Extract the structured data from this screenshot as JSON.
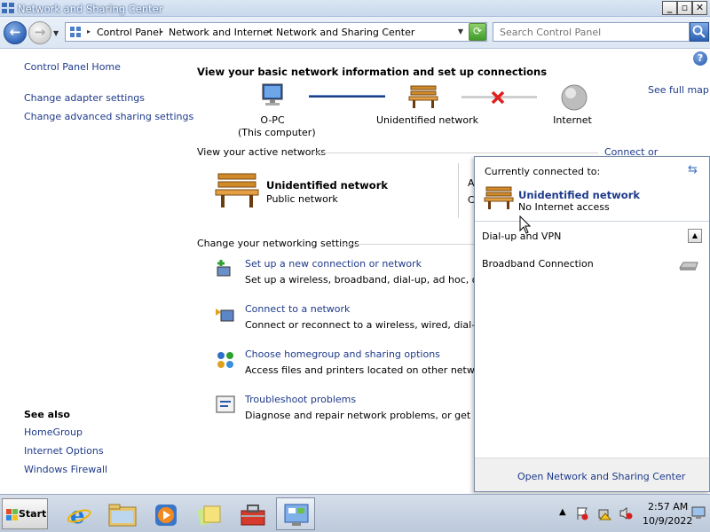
{
  "window": {
    "title": "Network and Sharing Center",
    "controls": {
      "minimize": "_",
      "maximize": "▫",
      "close": "✕"
    }
  },
  "address": {
    "breadcrumbs": [
      "Control Panel",
      "Network and Internet",
      "Network and Sharing Center"
    ],
    "search_placeholder": "Search Control Panel"
  },
  "sidebar": {
    "home": "Control Panel Home",
    "links": [
      "Change adapter settings",
      "Change advanced sharing settings"
    ],
    "see_also_title": "See also",
    "see_also": [
      "HomeGroup",
      "Internet Options",
      "Windows Firewall"
    ]
  },
  "main": {
    "heading": "View your basic network information and set up connections",
    "see_full_map": "See full map",
    "map": {
      "computer_name": "O-PC",
      "computer_sub": "(This computer)",
      "network": "Unidentified network",
      "internet": "Internet"
    },
    "active_networks_label": "View your active networks",
    "connect_or_disconnect": "Connect or disconnect",
    "active_network": {
      "name": "Unidentified network",
      "type": "Public network",
      "partial_a": "A",
      "partial_c": "C"
    },
    "settings_label": "Change your networking settings",
    "tasks": [
      {
        "title": "Set up a new connection or network",
        "desc": "Set up a wireless, broadband, dial-up, ad hoc, or VPN"
      },
      {
        "title": "Connect to a network",
        "desc": "Connect or reconnect to a wireless, wired, dial-up, or"
      },
      {
        "title": "Choose homegroup and sharing options",
        "desc": "Access files and printers located on other network cor"
      },
      {
        "title": "Troubleshoot problems",
        "desc": "Diagnose and repair network problems, or get trouble"
      }
    ]
  },
  "flyout": {
    "currently_connected": "Currently connected to:",
    "network_name": "Unidentified network",
    "network_status": "No Internet access",
    "section_dialup": "Dial-up and VPN",
    "item_broadband": "Broadband Connection",
    "footer_link": "Open Network and Sharing Center"
  },
  "taskbar": {
    "start": "Start",
    "time": "2:57 AM",
    "date": "10/9/2022"
  }
}
